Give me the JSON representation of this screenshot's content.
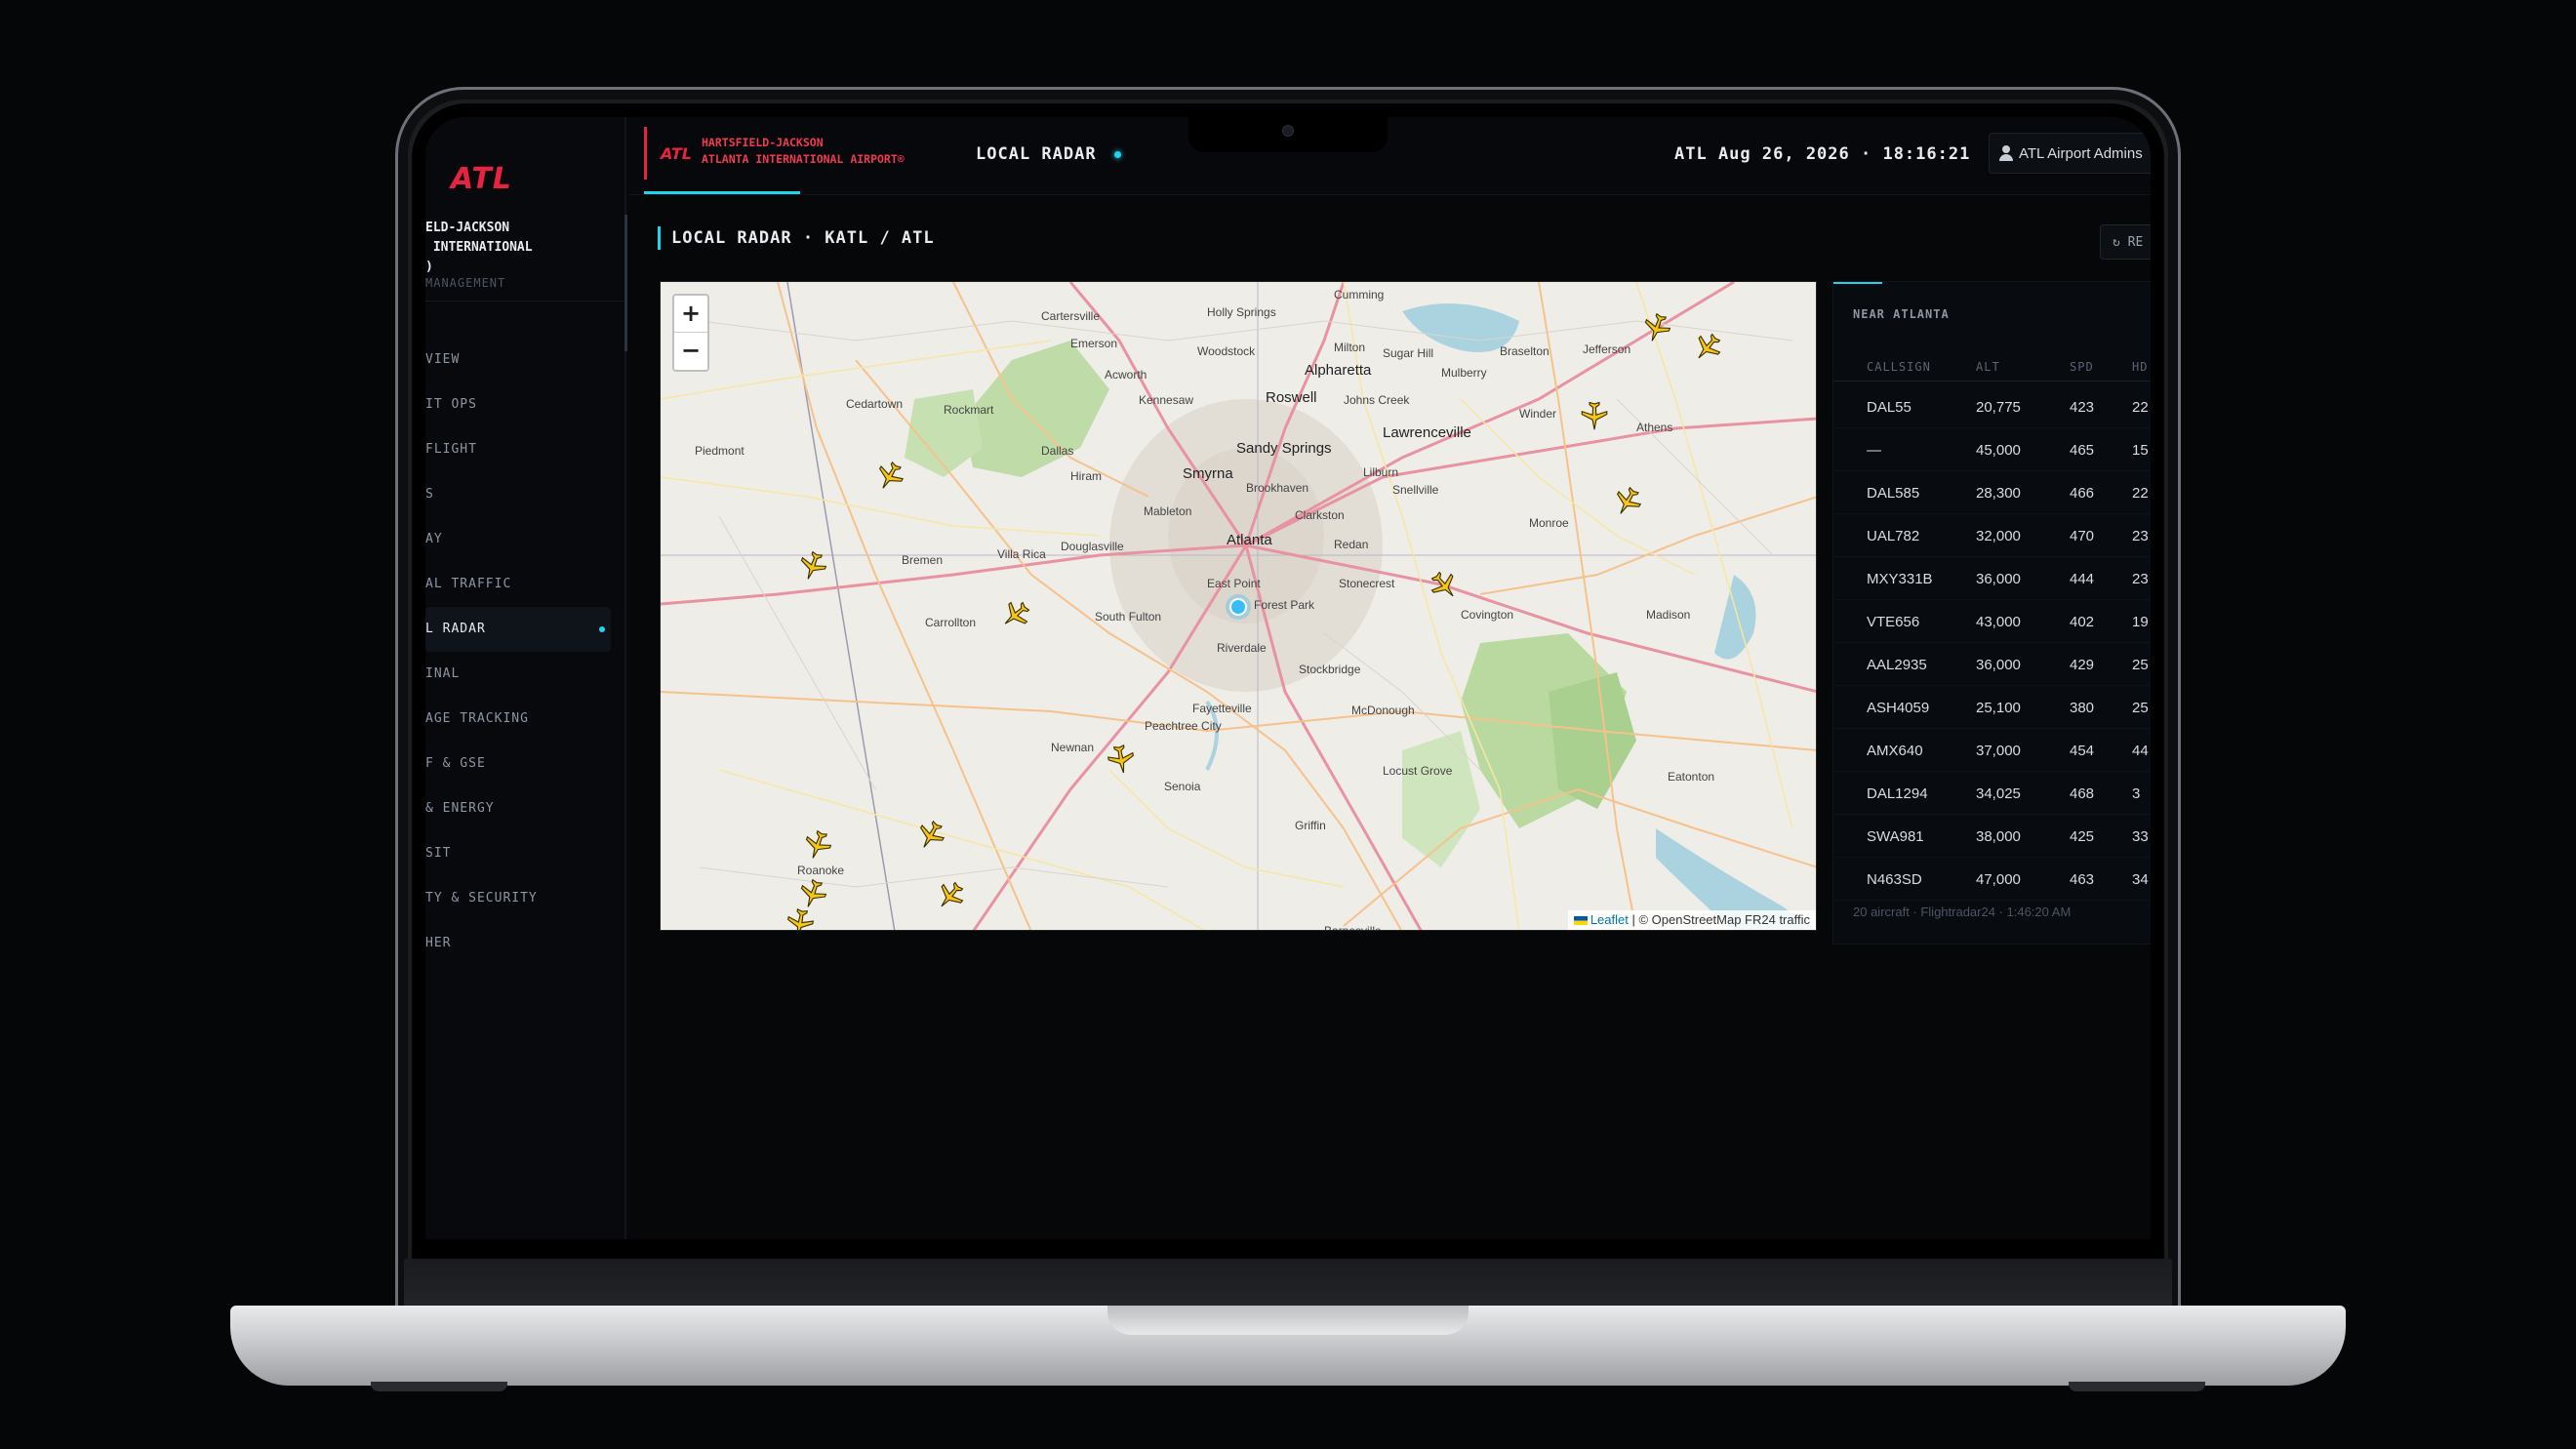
{
  "sidebar": {
    "logo": "ATL",
    "airport_name": "ELD-JACKSON\n INTERNATIONAL\n)",
    "subtitle": "MANAGEMENT",
    "items": [
      {
        "label": "VIEW"
      },
      {
        "label": "IT OPS"
      },
      {
        "label": "FLIGHT"
      },
      {
        "label": "S"
      },
      {
        "label": "AY"
      },
      {
        "label": "AL TRAFFIC"
      },
      {
        "label": "L RADAR",
        "active": true
      },
      {
        "label": "INAL"
      },
      {
        "label": "AGE TRACKING"
      },
      {
        "label": "F & GSE"
      },
      {
        "label": "& ENERGY"
      },
      {
        "label": "SIT"
      },
      {
        "label": "TY & SECURITY"
      },
      {
        "label": "HER"
      }
    ]
  },
  "header": {
    "brand_logo": "ATL",
    "brand_text": "HARTSFIELD-JACKSON\nATLANTA INTERNATIONAL AIRPORT®",
    "title": "LOCAL RADAR",
    "clock": "ATL Aug 26, 2026 · 18:16:21",
    "user": "ATL Airport Admins"
  },
  "page": {
    "title": "LOCAL RADAR · KATL / ATL",
    "refresh_label": "↻ RE"
  },
  "map": {
    "zoom_in": "+",
    "zoom_out": "−",
    "attribution_leaflet": "Leaflet",
    "attribution_rest": " | © OpenStreetMap  FR24 traffic",
    "cities": [
      {
        "name": "Cartersville"
      },
      {
        "name": "Holly Springs"
      },
      {
        "name": "Cumming"
      },
      {
        "name": "Emerson"
      },
      {
        "name": "Woodstock"
      },
      {
        "name": "Milton"
      },
      {
        "name": "Sugar Hill"
      },
      {
        "name": "Braselton"
      },
      {
        "name": "Jefferson"
      },
      {
        "name": "Acworth"
      },
      {
        "name": "Alpharetta"
      },
      {
        "name": "Kennesaw"
      },
      {
        "name": "Roswell"
      },
      {
        "name": "Johns Creek"
      },
      {
        "name": "Mulberry"
      },
      {
        "name": "Cedartown"
      },
      {
        "name": "Rockmart"
      },
      {
        "name": "Winder"
      },
      {
        "name": "Athens"
      },
      {
        "name": "Dallas"
      },
      {
        "name": "Sandy Springs"
      },
      {
        "name": "Lawrenceville"
      },
      {
        "name": "Piedmont"
      },
      {
        "name": "Smyrna"
      },
      {
        "name": "Hiram"
      },
      {
        "name": "Brookhaven"
      },
      {
        "name": "Lilburn"
      },
      {
        "name": "Snellville"
      },
      {
        "name": "Mableton"
      },
      {
        "name": "Clarkston"
      },
      {
        "name": "Monroe"
      },
      {
        "name": "Atlanta"
      },
      {
        "name": "Douglasville"
      },
      {
        "name": "Redan"
      },
      {
        "name": "Villa Rica"
      },
      {
        "name": "Bremen"
      },
      {
        "name": "East Point"
      },
      {
        "name": "Stonecrest"
      },
      {
        "name": "South Fulton"
      },
      {
        "name": "Forest Park"
      },
      {
        "name": "Carrollton"
      },
      {
        "name": "Covington"
      },
      {
        "name": "Madison"
      },
      {
        "name": "Riverdale"
      },
      {
        "name": "Stockbridge"
      },
      {
        "name": "Fayetteville"
      },
      {
        "name": "McDonough"
      },
      {
        "name": "Peachtree City"
      },
      {
        "name": "Newnan"
      },
      {
        "name": "Senoia"
      },
      {
        "name": "Locust Grove"
      },
      {
        "name": "Eatonton"
      },
      {
        "name": "Griffin"
      },
      {
        "name": "Roanoke"
      },
      {
        "name": "Barnesville"
      }
    ]
  },
  "panel": {
    "title": "NEAR ATLANTA",
    "columns": [
      "CALLSIGN",
      "ALT",
      "SPD",
      "HD"
    ],
    "rows": [
      {
        "callsign": "DAL55",
        "alt": "20,775",
        "spd": "423",
        "hdg": "22"
      },
      {
        "callsign": "—",
        "alt": "45,000",
        "spd": "465",
        "hdg": "15"
      },
      {
        "callsign": "DAL585",
        "alt": "28,300",
        "spd": "466",
        "hdg": "22"
      },
      {
        "callsign": "UAL782",
        "alt": "32,000",
        "spd": "470",
        "hdg": "23"
      },
      {
        "callsign": "MXY331B",
        "alt": "36,000",
        "spd": "444",
        "hdg": "23"
      },
      {
        "callsign": "VTE656",
        "alt": "43,000",
        "spd": "402",
        "hdg": "19"
      },
      {
        "callsign": "AAL2935",
        "alt": "36,000",
        "spd": "429",
        "hdg": "25"
      },
      {
        "callsign": "ASH4059",
        "alt": "25,100",
        "spd": "380",
        "hdg": "25"
      },
      {
        "callsign": "AMX640",
        "alt": "37,000",
        "spd": "454",
        "hdg": "44"
      },
      {
        "callsign": "DAL1294",
        "alt": "34,025",
        "spd": "468",
        "hdg": "3"
      },
      {
        "callsign": "SWA981",
        "alt": "38,000",
        "spd": "425",
        "hdg": "33"
      },
      {
        "callsign": "N463SD",
        "alt": "47,000",
        "spd": "463",
        "hdg": "34"
      }
    ],
    "footer": "20 aircraft · Flightradar24 · 1:46:20 AM"
  },
  "colors": {
    "accent": "#22d3ee",
    "brand": "#e8233f",
    "plane": "#f5c518"
  }
}
